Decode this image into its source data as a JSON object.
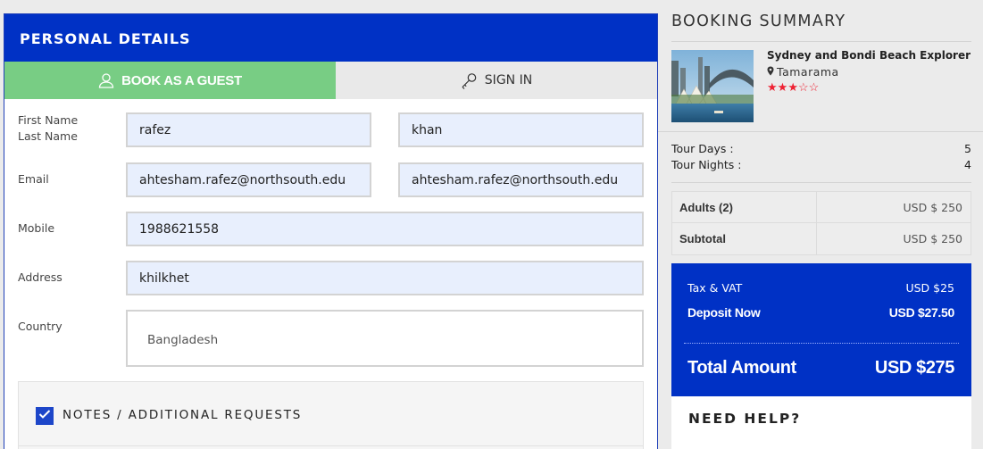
{
  "personal_details": {
    "title": "PERSONAL DETAILS",
    "tab_guest": "BOOK AS A GUEST",
    "tab_signin": "SIGN IN",
    "labels": {
      "first_name": "First Name",
      "last_name": "Last Name",
      "email": "Email",
      "mobile": "Mobile",
      "address": "Address",
      "country": "Country"
    },
    "values": {
      "first_name": "rafez",
      "last_name": "khan",
      "email": "ahtesham.rafez@northsouth.edu",
      "confirm_email": "ahtesham.rafez@northsouth.edu",
      "mobile": "1988621558",
      "address": "khilkhet",
      "country": "Bangladesh"
    },
    "notes_label": "NOTES / ADDITIONAL REQUESTS",
    "notes_checked": true
  },
  "booking_summary": {
    "title": "BOOKING SUMMARY",
    "tour_name": "Sydney and Bondi Beach Explorer",
    "location": "Tamarama",
    "stars_filled": 3,
    "stars_total": 5,
    "tour_days_label": "Tour Days :",
    "tour_days": "5",
    "tour_nights_label": "Tour Nights :",
    "tour_nights": "4",
    "adults_label": "Adults (2)",
    "adults_value": "USD $ 250",
    "subtotal_label": "Subtotal",
    "subtotal_value": "USD $ 250",
    "tax_label": "Tax & VAT",
    "tax_value": "USD $25",
    "deposit_label": "Deposit Now",
    "deposit_value": "USD $27.50",
    "total_label": "Total Amount",
    "total_value": "USD $275",
    "help_title": "NEED HELP?"
  },
  "colors": {
    "primary_blue": "#0031c5",
    "guest_tab_green": "#78cd84",
    "input_fill": "#e8effd",
    "star_red": "#e23333"
  }
}
